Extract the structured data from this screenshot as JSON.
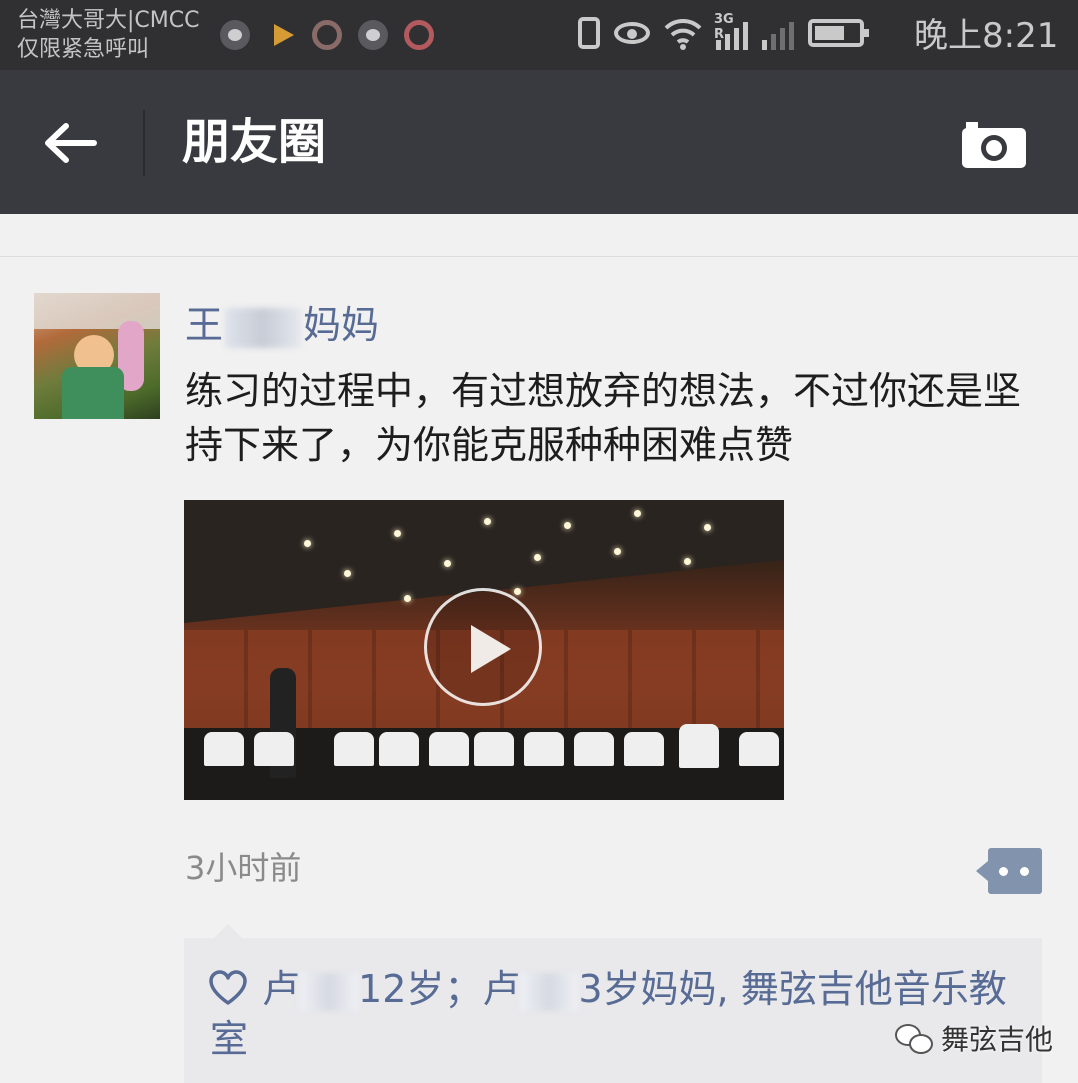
{
  "status_bar": {
    "carrier_line1": "台灣大哥大|CMCC",
    "carrier_line2": "仅限紧急呼叫",
    "network_label": "3G R",
    "time": "晚上8:21",
    "icons": [
      "app-icon-cat",
      "app-icon-play",
      "app-icon-ring",
      "app-icon-cat",
      "app-icon-ring",
      "vibrate-icon",
      "eye-icon",
      "wifi-icon",
      "signal-icon",
      "signal-icon",
      "battery-icon"
    ]
  },
  "nav": {
    "title": "朋友圈",
    "back_icon": "arrow-left-icon",
    "camera_icon": "camera-icon"
  },
  "post": {
    "author_visible_start": "王",
    "author_visible_end": "妈妈",
    "text": "练习的过程中，有过想放弃的想法，不过你还是坚持下来了，为你能克服种种困难点赞",
    "media_type": "video",
    "time_ago": "3小时前"
  },
  "likes": {
    "segment1_start": "卢",
    "segment1_end": "12岁；卢",
    "segment2_end": "3岁妈妈, 舞弦吉他音乐教室"
  },
  "watermark": {
    "text": "舞弦吉他"
  },
  "colors": {
    "status_bg": "#303033",
    "nav_bg": "#393a3f",
    "name_blue": "#576b95",
    "likes_bg": "#e9e9ec",
    "comment_button": "#8193ad"
  }
}
